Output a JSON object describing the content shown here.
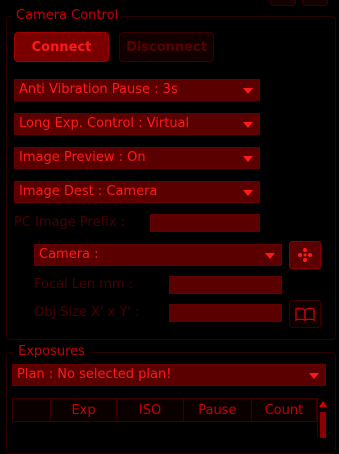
{
  "camera_control": {
    "title": "Camera Control",
    "connect_label": "Connect",
    "disconnect_label": "Disconnect",
    "anti_vibration": "Anti Vibration Pause : 3s",
    "long_exp": "Long Exp. Control : Virtual",
    "image_preview": "Image Preview : On",
    "image_dest": "Image Dest : Camera",
    "pc_prefix_label": "PC Image Prefix :",
    "camera_select": "Camera :",
    "focal_len_label": "Focal Len mm :",
    "obj_size_label": "Obj Size X' x Y' :"
  },
  "exposures": {
    "title": "Exposures",
    "plan": "Plan : No selected plan!",
    "columns": [
      "",
      "Exp",
      "ISO",
      "Pause",
      "Count"
    ]
  },
  "colors": {
    "background": "#000000",
    "accent": "#ff1a1a",
    "control_fill": "#5a0000",
    "disabled_text": "#4a0000"
  },
  "icons": {
    "camera_settings": "dots-cluster-icon",
    "lens_library": "open-book-icon"
  }
}
